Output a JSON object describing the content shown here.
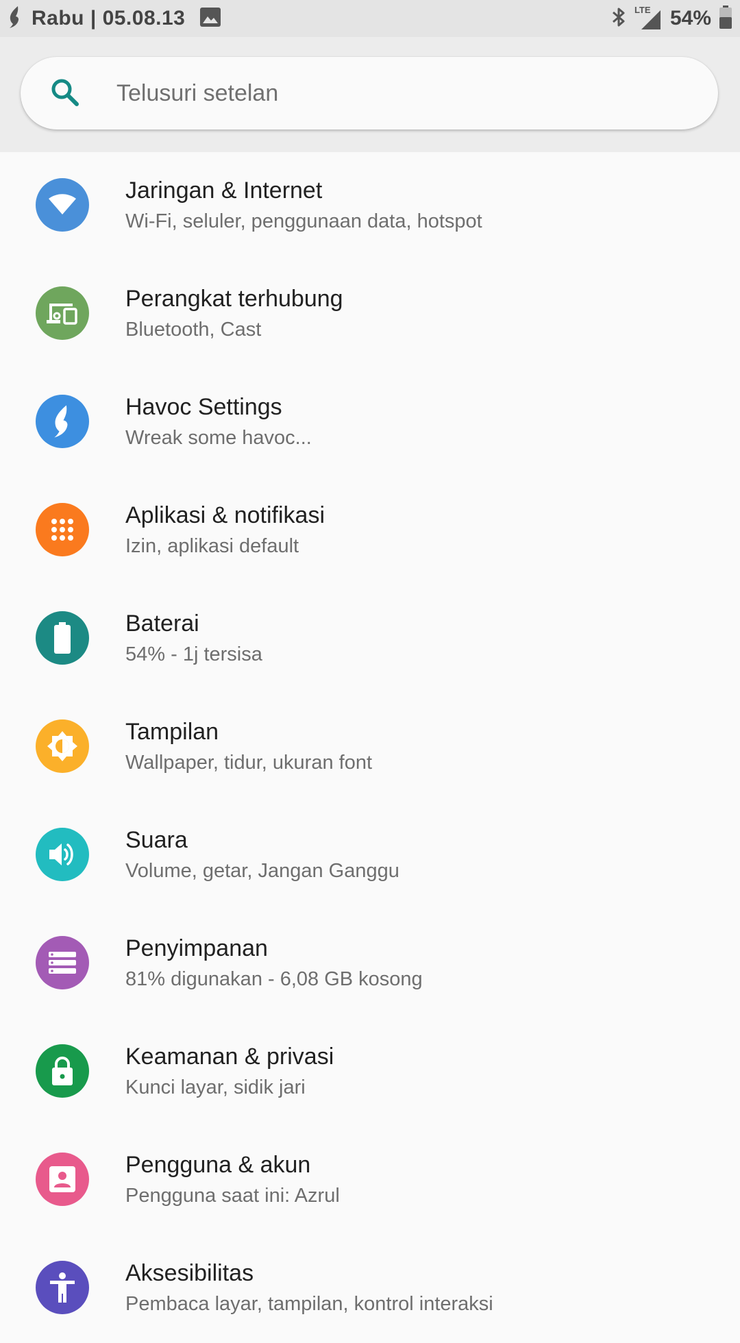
{
  "status_bar": {
    "time": "Rabu | 05.08.13",
    "network": "LTE",
    "battery": "54%"
  },
  "search": {
    "placeholder": "Telusuri setelan",
    "icon": "search-icon"
  },
  "settings": [
    {
      "title": "Jaringan & Internet",
      "subtitle": "Wi-Fi, seluler, penggunaan data, hotspot",
      "icon": "wifi-icon",
      "color": "#4a90d9"
    },
    {
      "title": "Perangkat terhubung",
      "subtitle": "Bluetooth, Cast",
      "icon": "devices-icon",
      "color": "#6fa65d"
    },
    {
      "title": "Havoc Settings",
      "subtitle": "Wreak some havoc...",
      "icon": "havoc-flame-icon",
      "color": "#3d8fe0"
    },
    {
      "title": "Aplikasi & notifikasi",
      "subtitle": "Izin, aplikasi default",
      "icon": "apps-grid-icon",
      "color": "#fa7a1e"
    },
    {
      "title": "Baterai",
      "subtitle": "54% - 1j tersisa",
      "icon": "battery-icon",
      "color": "#1c8a84"
    },
    {
      "title": "Tampilan",
      "subtitle": "Wallpaper, tidur, ukuran font",
      "icon": "brightness-icon",
      "color": "#fbb02a"
    },
    {
      "title": "Suara",
      "subtitle": "Volume, getar, Jangan Ganggu",
      "icon": "volume-icon",
      "color": "#22bcc0"
    },
    {
      "title": "Penyimpanan",
      "subtitle": "81% digunakan - 6,08 GB kosong",
      "icon": "storage-icon",
      "color": "#a35bb5"
    },
    {
      "title": "Keamanan & privasi",
      "subtitle": "Kunci layar, sidik jari",
      "icon": "lock-icon",
      "color": "#189a4c"
    },
    {
      "title": "Pengguna & akun",
      "subtitle": "Pengguna saat ini: Azrul",
      "icon": "account-icon",
      "color": "#e85a8c"
    },
    {
      "title": "Aksesibilitas",
      "subtitle": "Pembaca layar, tampilan, kontrol interaksi",
      "icon": "accessibility-icon",
      "color": "#5a4ebd"
    }
  ]
}
